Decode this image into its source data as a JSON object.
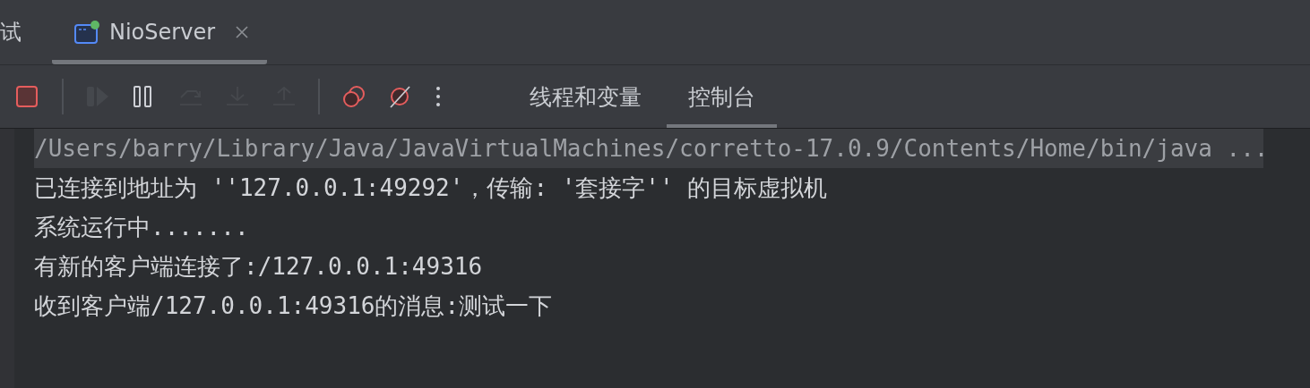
{
  "tabs": [
    {
      "label": "试",
      "selected": false,
      "kind": "plain"
    },
    {
      "label": "NioServer",
      "selected": true,
      "kind": "run",
      "running": true,
      "closable": true
    }
  ],
  "toolbar": [
    {
      "kind": "stop",
      "disabled": false
    },
    {
      "kind": "separator"
    },
    {
      "kind": "resume",
      "disabled": true
    },
    {
      "kind": "pause",
      "disabled": false
    },
    {
      "kind": "step-over",
      "disabled": true
    },
    {
      "kind": "step-into",
      "disabled": true
    },
    {
      "kind": "step-out",
      "disabled": true
    },
    {
      "kind": "separator"
    },
    {
      "kind": "breakpoints",
      "disabled": false
    },
    {
      "kind": "mute",
      "disabled": false
    },
    {
      "kind": "more",
      "disabled": false
    }
  ],
  "view_tabs": [
    {
      "label": "线程和变量",
      "selected": false
    },
    {
      "label": "控制台",
      "selected": true
    }
  ],
  "console": [
    {
      "kind": "command",
      "text": "/Users/barry/Library/Java/JavaVirtualMachines/corretto-17.0.9/Contents/Home/bin/java ..."
    },
    {
      "kind": "output",
      "text": "已连接到地址为 ''127.0.0.1:49292'，传输: '套接字'' 的目标虚拟机"
    },
    {
      "kind": "output",
      "text": "系统运行中......."
    },
    {
      "kind": "output",
      "text": "有新的客户端连接了:/127.0.0.1:49316"
    },
    {
      "kind": "output",
      "text": "收到客户端/127.0.0.1:49316的消息:测试一下"
    }
  ]
}
